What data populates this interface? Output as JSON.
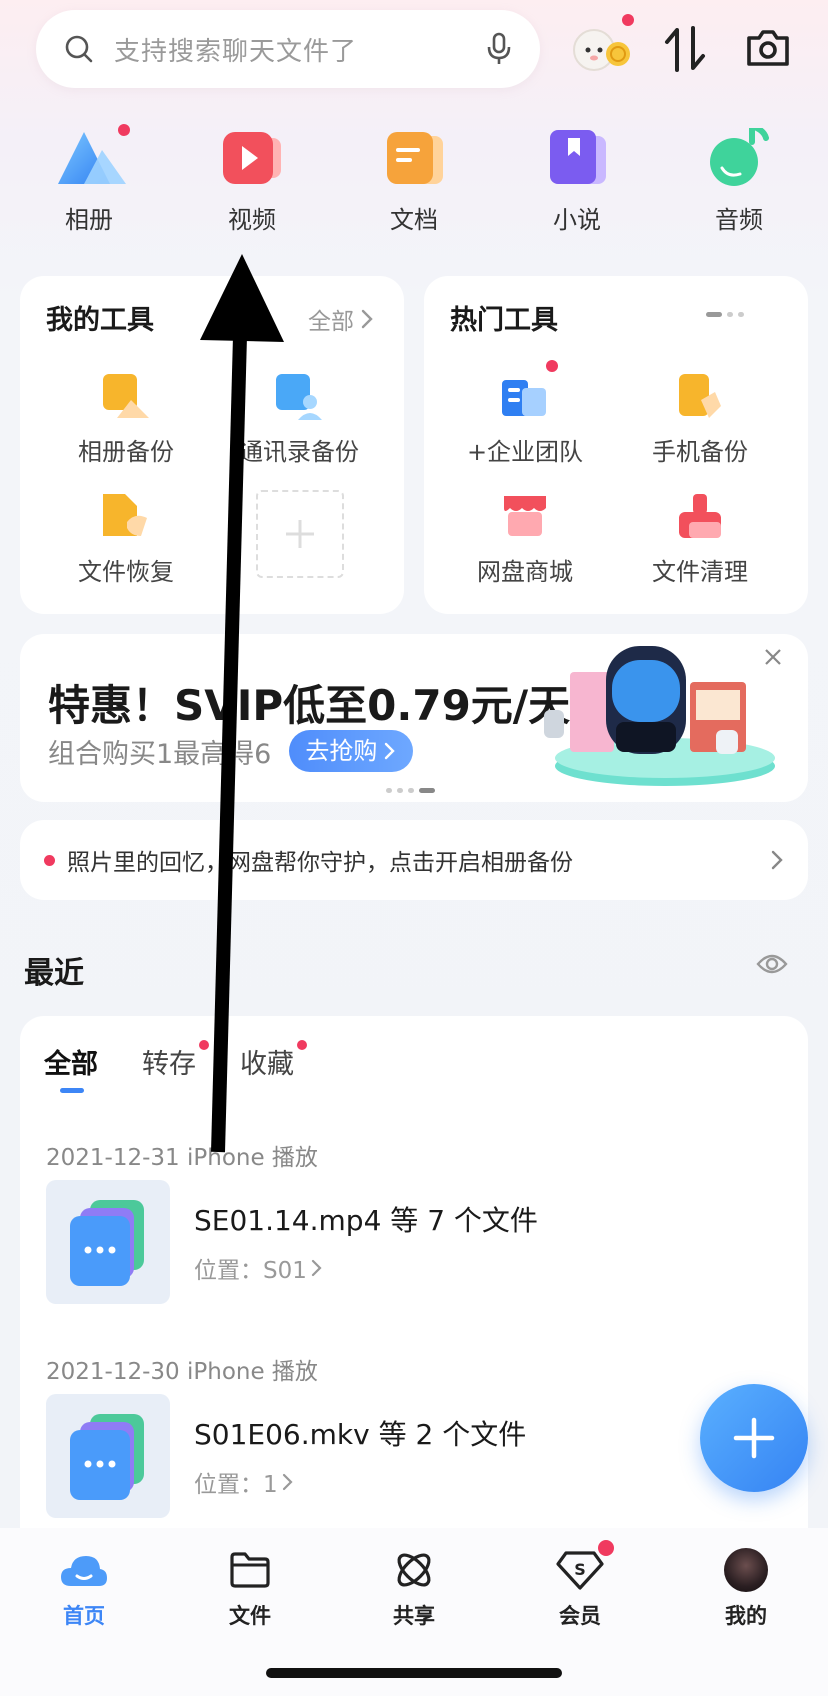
{
  "search": {
    "placeholder": "支持搜索聊天文件了"
  },
  "quick_entries": [
    {
      "label": "相册",
      "icon": "album-icon",
      "badge": true
    },
    {
      "label": "视频",
      "icon": "video-icon",
      "badge": false
    },
    {
      "label": "文档",
      "icon": "document-icon",
      "badge": false
    },
    {
      "label": "小说",
      "icon": "novel-icon",
      "badge": false
    },
    {
      "label": "音频",
      "icon": "audio-icon",
      "badge": false
    }
  ],
  "my_tools": {
    "title": "我的工具",
    "all_label": "全部",
    "items": [
      {
        "label": "相册备份",
        "icon": "album-backup-icon"
      },
      {
        "label": "通讯录备份",
        "icon": "contacts-backup-icon"
      },
      {
        "label": "文件恢复",
        "icon": "file-restore-icon"
      }
    ]
  },
  "hot_tools": {
    "title": "热门工具",
    "items": [
      {
        "label": "+企业团队",
        "icon": "enterprise-team-icon",
        "badge": true
      },
      {
        "label": "手机备份",
        "icon": "phone-backup-icon"
      },
      {
        "label": "网盘商城",
        "icon": "store-icon"
      },
      {
        "label": "文件清理",
        "icon": "file-cleanup-icon"
      }
    ]
  },
  "banner": {
    "title": "特惠！SVIP低至0.79元/天",
    "subtitle": "组合购买1最高得6",
    "cta": "去抢购"
  },
  "notice": {
    "text": "照片里的回忆，网盘帮你守护，点击开启相册备份"
  },
  "recent": {
    "title": "最近",
    "tabs": [
      {
        "label": "全部",
        "active": true,
        "badge": false
      },
      {
        "label": "转存",
        "active": false,
        "badge": true
      },
      {
        "label": "收藏",
        "active": false,
        "badge": true
      }
    ],
    "groups": [
      {
        "date": "2021-12-31 iPhone 播放",
        "name": "SE01.14.mp4 等 7 个文件",
        "location": "位置：S01"
      },
      {
        "date": "2021-12-30 iPhone 播放",
        "name": "S01E06.mkv 等 2 个文件",
        "location": "位置：1"
      }
    ]
  },
  "bottom_nav": [
    {
      "label": "首页",
      "icon": "home-cloud-icon",
      "active": true
    },
    {
      "label": "文件",
      "icon": "folder-icon",
      "active": false
    },
    {
      "label": "共享",
      "icon": "share-icon",
      "active": false
    },
    {
      "label": "会员",
      "icon": "vip-diamond-icon",
      "active": false,
      "badge": true
    },
    {
      "label": "我的",
      "icon": "avatar",
      "active": false
    }
  ],
  "colors": {
    "accent": "#3d86f6",
    "badge": "#f03a5f",
    "arrow": "#000000"
  }
}
